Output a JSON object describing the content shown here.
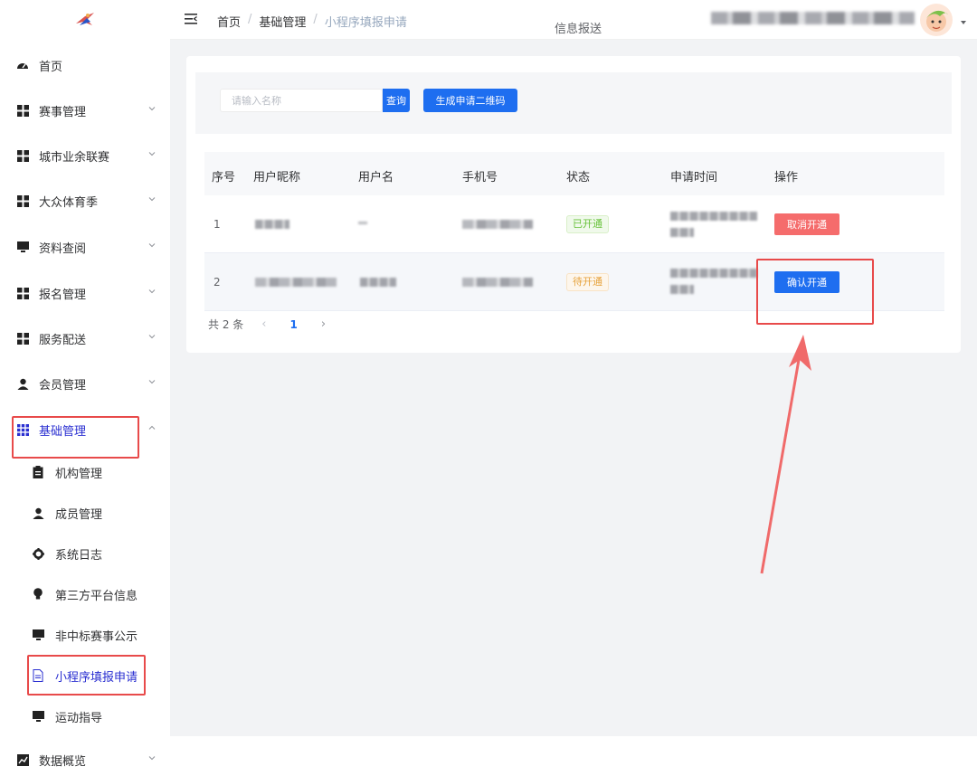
{
  "header": {
    "breadcrumb": [
      "首页",
      "基础管理",
      "小程序填报申请"
    ],
    "center_title": "信息报送"
  },
  "sidebar": {
    "items": [
      {
        "label": "首页",
        "icon": "dashboard-icon"
      },
      {
        "label": "赛事管理",
        "icon": "grid-icon"
      },
      {
        "label": "城市业余联赛",
        "icon": "grid-icon"
      },
      {
        "label": "大众体育季",
        "icon": "grid-icon"
      },
      {
        "label": "资料查阅",
        "icon": "monitor-icon"
      },
      {
        "label": "报名管理",
        "icon": "grid-icon"
      },
      {
        "label": "服务配送",
        "icon": "grid-icon"
      },
      {
        "label": "会员管理",
        "icon": "user-icon"
      },
      {
        "label": "基础管理",
        "icon": "apps-icon"
      },
      {
        "label": "数据概览",
        "icon": "chart-icon"
      }
    ],
    "sub_items": [
      {
        "label": "机构管理",
        "icon": "clipboard-icon"
      },
      {
        "label": "成员管理",
        "icon": "user-icon"
      },
      {
        "label": "系统日志",
        "icon": "gear-icon"
      },
      {
        "label": "第三方平台信息",
        "icon": "bulb-icon"
      },
      {
        "label": "非中标赛事公示",
        "icon": "monitor-icon"
      },
      {
        "label": "小程序填报申请",
        "icon": "document-icon"
      },
      {
        "label": "运动指导",
        "icon": "monitor-icon"
      }
    ]
  },
  "search": {
    "placeholder": "请输入名称",
    "query_label": "查询",
    "qr_label": "生成申请二维码"
  },
  "table": {
    "headers": [
      "序号",
      "用户昵称",
      "用户名",
      "手机号",
      "状态",
      "申请时间",
      "操作"
    ],
    "rows": [
      {
        "index": "1",
        "status": "已开通",
        "action": "取消开通"
      },
      {
        "index": "2",
        "status": "待开通",
        "action": "确认开通"
      }
    ]
  },
  "pagination": {
    "total": "共 2 条",
    "prev": "‹",
    "page": "1",
    "next": "›"
  },
  "colors": {
    "primary": "#1e6ef0",
    "danger": "#f56c6c",
    "annotation": "#e84a4a",
    "active_menu": "#2a2fd1"
  }
}
